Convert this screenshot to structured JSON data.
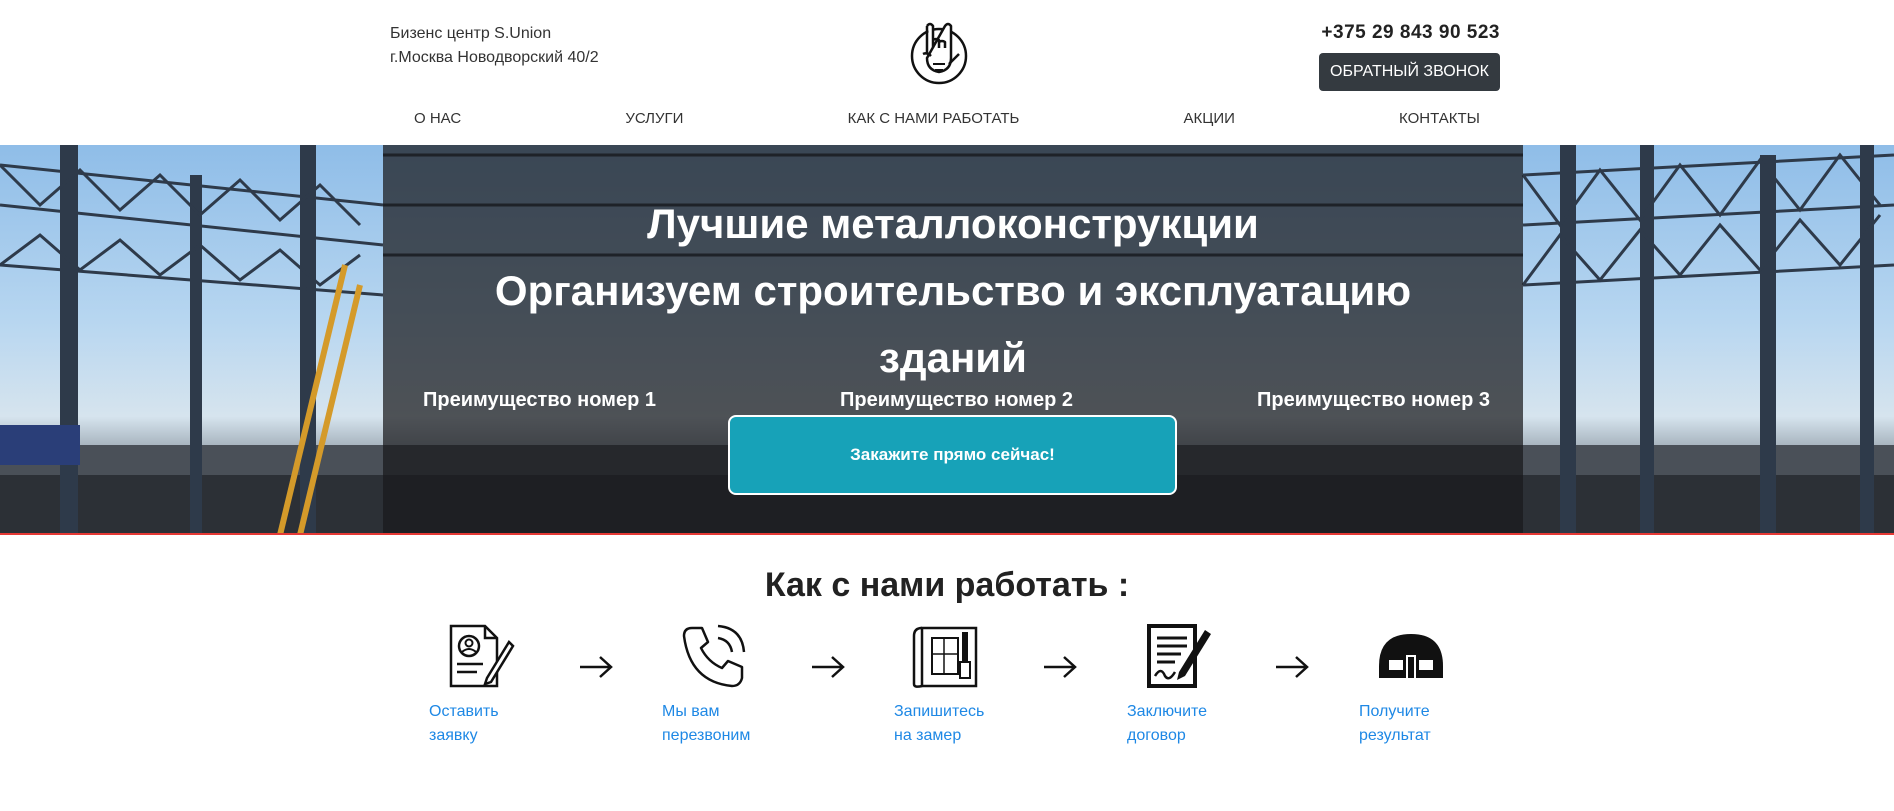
{
  "header": {
    "address_line1": "Бизенс центр S.Union",
    "address_line2": "г.Москва Новодворский 40/2",
    "logo_icon": "rock-hand-logo-icon",
    "phone": "+375 29 843 90 523",
    "callback_label": "ОБРАТНЫЙ ЗВОНОК"
  },
  "nav": {
    "items": [
      {
        "label": "О НАС"
      },
      {
        "label": "УСЛУГИ"
      },
      {
        "label": "КАК С НАМИ РАБОТАТЬ"
      },
      {
        "label": "АКЦИИ"
      },
      {
        "label": "КОНТАКТЫ"
      }
    ]
  },
  "hero": {
    "title_line1": "Лучшие металлоконструкции",
    "title_line2": "Организуем строительство и эксплуатацию",
    "title_line3": "зданий",
    "advantages": [
      "Преимущество номер 1",
      "Преимущество номер 2",
      "Преимущество номер 3"
    ],
    "cta_label": "Закажите прямо сейчас!",
    "cta_color": "#17a2b8"
  },
  "steps": {
    "title": "Как с нами работать :",
    "items": [
      {
        "line1": "Оставить",
        "line2": "заявку",
        "icon": "application-form-icon"
      },
      {
        "line1": "Мы вам",
        "line2": "перезвоним",
        "icon": "phone-call-icon"
      },
      {
        "line1": "Запишитесь",
        "line2": "на замер",
        "icon": "blueprint-measure-icon"
      },
      {
        "line1": "Заключите",
        "line2": "договор",
        "icon": "contract-sign-icon"
      },
      {
        "line1": "Получите",
        "line2": "результат",
        "icon": "hangar-icon"
      }
    ],
    "link_color": "#1e88e5"
  }
}
